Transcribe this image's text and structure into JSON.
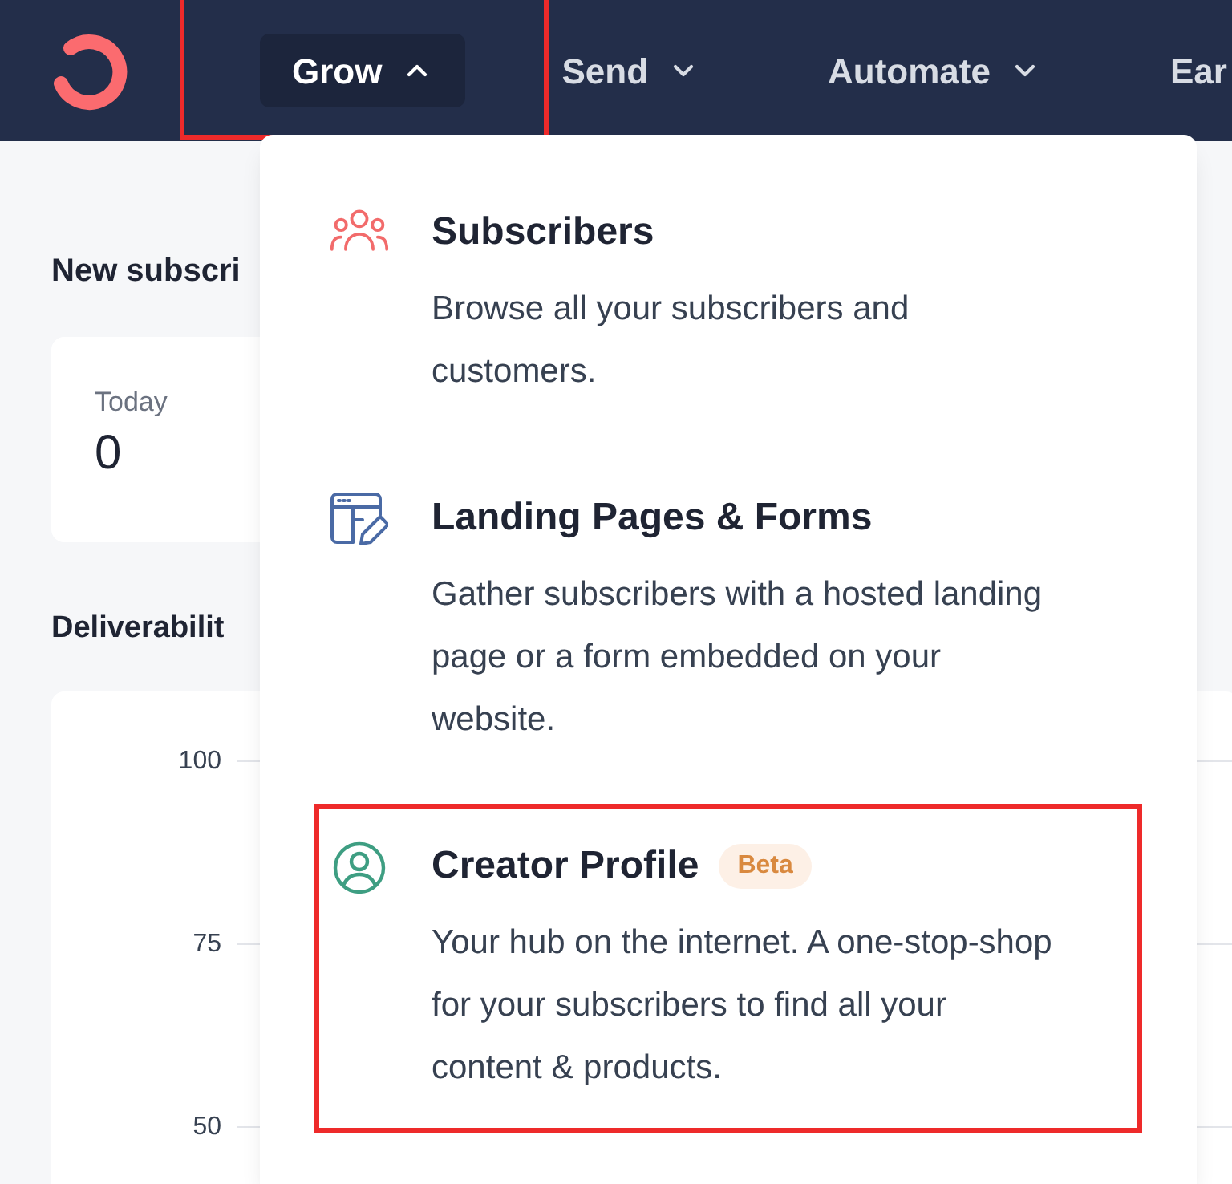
{
  "nav": {
    "items": [
      {
        "label": "Grow",
        "selected": true,
        "expanded": true,
        "highlighted": true
      },
      {
        "label": "Send",
        "selected": false,
        "expanded": false,
        "highlighted": false
      },
      {
        "label": "Automate",
        "selected": false,
        "expanded": false,
        "highlighted": false
      },
      {
        "label": "Ear",
        "selected": false,
        "highlighted": false
      }
    ]
  },
  "new_subscribers": {
    "title": "New subscri",
    "stat": {
      "label": "Today",
      "value": "0"
    }
  },
  "deliverability": {
    "title": "Deliverabilit",
    "yticks": [
      "100",
      "75",
      "50"
    ]
  },
  "menu": {
    "items": [
      {
        "kind": "people",
        "color": "#f26b6b",
        "title": "Subscribers",
        "description": "Browse all your subscribers and customers.",
        "highlighted": false
      },
      {
        "kind": "form",
        "color": "#4a6aa5",
        "title": "Landing Pages & Forms",
        "description": "Gather subscribers with a hosted landing page or a form embedded on your website.",
        "highlighted": false
      },
      {
        "kind": "user",
        "color": "#3e9e82",
        "title": "Creator Profile",
        "badge": "Beta",
        "description": "Your hub on the internet. A one-stop-shop for your subscribers to find all your content & products.",
        "highlighted": true
      }
    ]
  }
}
